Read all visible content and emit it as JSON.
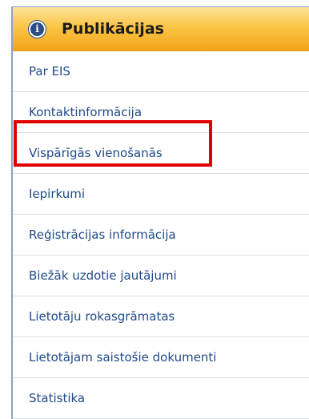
{
  "header": {
    "icon": "info-icon",
    "icon_glyph": "i",
    "title": "Publikācijas"
  },
  "menu": {
    "items": [
      {
        "label": "Par EIS"
      },
      {
        "label": "Kontaktinformācija"
      },
      {
        "label": "Vispārīgās vienošanās"
      },
      {
        "label": "Iepirkumi"
      },
      {
        "label": "Reģistrācijas informācija"
      },
      {
        "label": "Biežāk uzdotie jautājumi"
      },
      {
        "label": "Lietotāju rokasgrāmatas"
      },
      {
        "label": "Lietotājam saistošie dokumenti"
      },
      {
        "label": "Statistika"
      }
    ]
  },
  "highlight": {
    "target": "Vispārīgās vienošanās",
    "color": "#e00000"
  },
  "colors": {
    "header_gradient_top": "#fde29a",
    "header_gradient_bottom": "#f2a51a",
    "link": "#1f4a8a",
    "icon_background": "#2d4d86"
  }
}
